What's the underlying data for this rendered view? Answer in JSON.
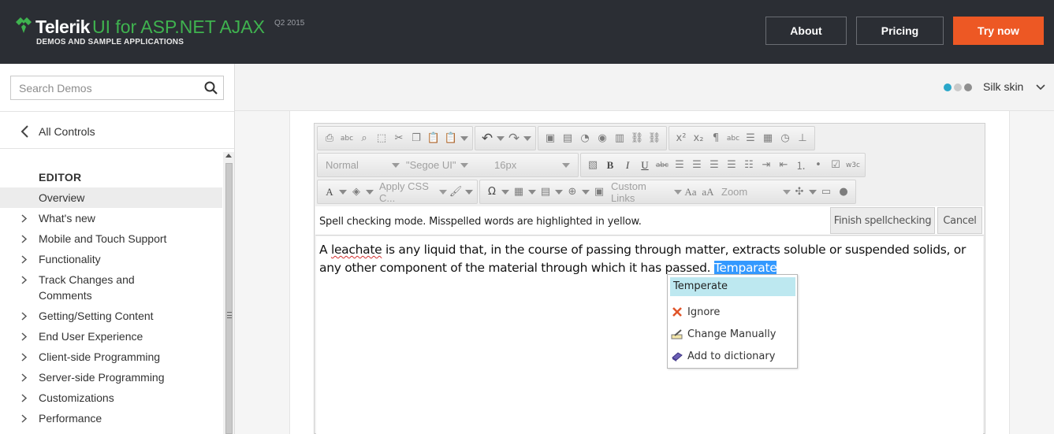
{
  "header": {
    "brand": "Telerik",
    "product": "UI for ASP.NET AJAX",
    "version": "Q2 2015",
    "subtitle": "DEMOS AND SAMPLE APPLICATIONS",
    "buttons": {
      "about": "About",
      "pricing": "Pricing",
      "try_now": "Try now"
    },
    "colors": {
      "background": "#2b2e34",
      "accent": "#3fb34f",
      "try_now": "#ed5824"
    }
  },
  "sidebar": {
    "search": {
      "placeholder": "Search Demos",
      "value": ""
    },
    "back_link": "All Controls",
    "section": "EDITOR",
    "items": [
      {
        "label": "Overview",
        "active": true,
        "expandable": false
      },
      {
        "label": "What's new",
        "expandable": true
      },
      {
        "label": "Mobile and Touch Support",
        "expandable": true
      },
      {
        "label": "Functionality",
        "expandable": true
      },
      {
        "label": "Track Changes and Comments",
        "expandable": true
      },
      {
        "label": "Getting/Setting Content",
        "expandable": true
      },
      {
        "label": "End User Experience",
        "expandable": true
      },
      {
        "label": "Client-side Programming",
        "expandable": true
      },
      {
        "label": "Server-side Programming",
        "expandable": true
      },
      {
        "label": "Customizations",
        "expandable": true
      },
      {
        "label": "Performance",
        "expandable": true
      }
    ]
  },
  "skin": {
    "label": "Silk skin",
    "dot_colors": [
      "#2aa7c9",
      "#c9c9c9",
      "#8f8f8f"
    ]
  },
  "editor": {
    "toolbar": {
      "paragraph_style": "Normal",
      "font_name": "\"Segoe UI\"",
      "font_size": "16px",
      "css_class": "Apply CSS C...",
      "custom_links": "Custom Links",
      "zoom": "Zoom"
    },
    "spellcheck": {
      "message": "Spell checking mode. Misspelled words are highlighted in yellow.",
      "finish_button": "Finish spellchecking",
      "cancel_button": "Cancel"
    },
    "content": {
      "part1": "A ",
      "misspelled_word": "leachate",
      "part2": " is any liquid that, in the course of passing through matter, extracts soluble or suspended solids, or any other component of the material through which it has passed. ",
      "selected_word": "Temparate"
    },
    "context_menu": {
      "suggestion": "Temperate",
      "ignore": "Ignore",
      "change_manually": "Change Manually",
      "add_to_dictionary": "Add to dictionary"
    }
  }
}
